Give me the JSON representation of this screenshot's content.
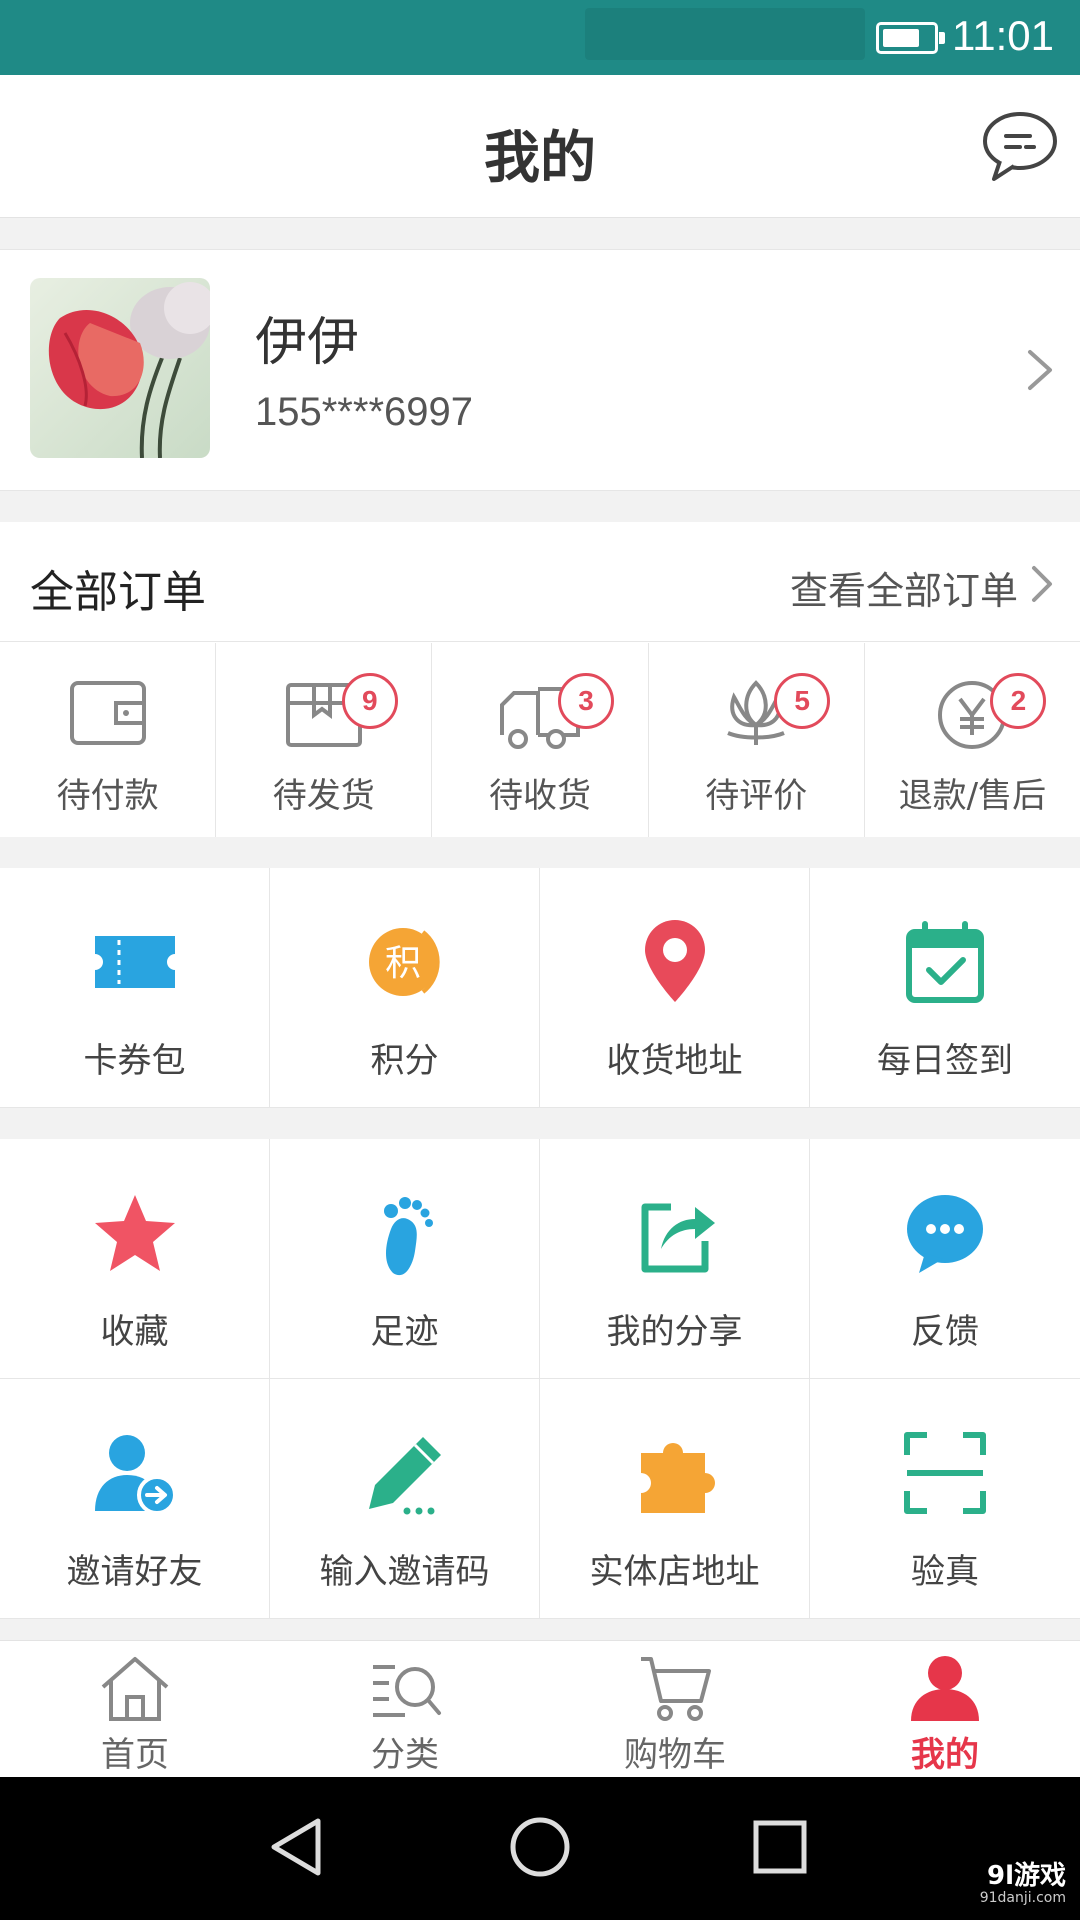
{
  "status_bar": {
    "time": "11:01",
    "battery_icon": "battery-icon"
  },
  "header": {
    "title": "我的",
    "message_icon": "message-icon"
  },
  "profile": {
    "name": "伊伊",
    "phone": "155****6997"
  },
  "orders": {
    "title": "全部订单",
    "view_all": "查看全部订单",
    "items": [
      {
        "label": "待付款",
        "icon": "wallet-icon",
        "badge": ""
      },
      {
        "label": "待发货",
        "icon": "box-icon",
        "badge": "9"
      },
      {
        "label": "待收货",
        "icon": "truck-icon",
        "badge": "3"
      },
      {
        "label": "待评价",
        "icon": "flower-icon",
        "badge": "5"
      },
      {
        "label": "退款/售后",
        "icon": "yen-coin-icon",
        "badge": "2"
      }
    ]
  },
  "services": [
    {
      "label": "卡券包",
      "icon": "ticket-icon"
    },
    {
      "label": "积分",
      "icon": "points-icon",
      "icon_text": "积"
    },
    {
      "label": "收货地址",
      "icon": "location-pin-icon"
    },
    {
      "label": "每日签到",
      "icon": "calendar-check-icon"
    }
  ],
  "tools": [
    {
      "label": "收藏",
      "icon": "star-icon"
    },
    {
      "label": "足迹",
      "icon": "footprint-icon"
    },
    {
      "label": "我的分享",
      "icon": "share-icon"
    },
    {
      "label": "反馈",
      "icon": "chat-bubble-icon"
    },
    {
      "label": "邀请好友",
      "icon": "invite-user-icon"
    },
    {
      "label": "输入邀请码",
      "icon": "pencil-icon"
    },
    {
      "label": "实体店地址",
      "icon": "puzzle-icon"
    },
    {
      "label": "验真",
      "icon": "scan-icon"
    }
  ],
  "tabbar": [
    {
      "label": "首页",
      "icon": "home-icon",
      "active": false
    },
    {
      "label": "分类",
      "icon": "category-search-icon",
      "active": false
    },
    {
      "label": "购物车",
      "icon": "cart-icon",
      "active": false
    },
    {
      "label": "我的",
      "icon": "user-icon",
      "active": true
    }
  ],
  "watermark": {
    "brand": "9l游戏",
    "url": "91danji.com"
  },
  "colors": {
    "status_bar": "#1f8a86",
    "accent_red": "#e6364a",
    "badge_red": "#e24a5b",
    "blue": "#29a4e0",
    "green": "#2bb08a",
    "orange": "#f5a535"
  }
}
